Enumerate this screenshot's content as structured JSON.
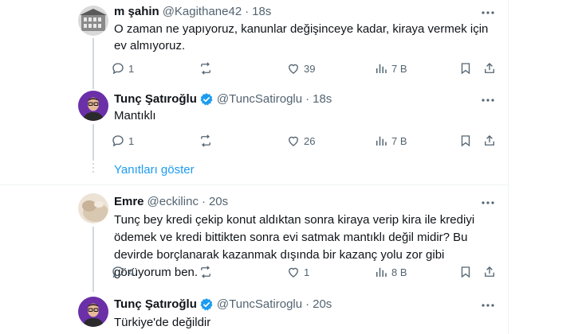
{
  "tweets": [
    {
      "name": "m şahin",
      "handle": "@Kagithane42",
      "time": "18s",
      "text": "O zaman ne yapıyoruz, kanunlar değişinceye kadar, kiraya vermek için ev almıyoruz.",
      "replies": "1",
      "retweets": "",
      "likes": "39",
      "views": "7 B"
    },
    {
      "name": "Tunç Şatıroğlu",
      "handle": "@TuncSatiroglu",
      "time": "18s",
      "text": "Mantıklı",
      "replies": "1",
      "retweets": "",
      "likes": "26",
      "views": "7 B"
    },
    {
      "name": "Emre",
      "handle": "@eckilinc",
      "time": "20s",
      "text": "Tunç bey kredi çekip konut aldıktan sonra kiraya verip kira ile krediyi ödemek ve kredi bittikten sonra evi satmak mantıklı değil midir? Bu devirde borçlanarak kazanmak dışında bir kazanç yolu zor gibi görüyorum ben.",
      "replies": "4",
      "retweets": "",
      "likes": "1",
      "views": "8 B"
    },
    {
      "name": "Tunç Şatıroğlu",
      "handle": "@TuncSatiroglu",
      "time": "20s",
      "text": "Türkiye'de değildir"
    }
  ],
  "show_replies_label": "Yanıtları göster",
  "colors": {
    "verified": "#1d9bf0",
    "link": "#1d9bf0",
    "muted": "#536471"
  },
  "icons": [
    "more-icon",
    "reply-icon",
    "retweet-icon",
    "like-icon",
    "views-icon",
    "bookmark-icon",
    "share-icon",
    "verified-badge-icon"
  ]
}
